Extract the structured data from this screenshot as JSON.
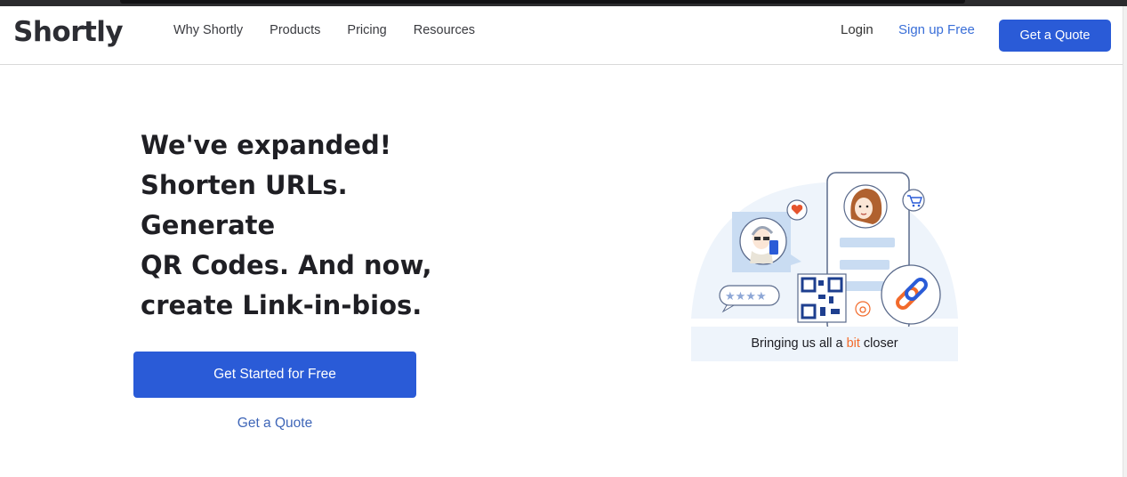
{
  "header": {
    "logo": "Shortly",
    "menu": [
      "Why Shortly",
      "Products",
      "Pricing",
      "Resources"
    ],
    "login": "Login",
    "signup": "Sign up Free",
    "quote_button": "Get a Quote"
  },
  "hero": {
    "headline_lines": [
      "We've expanded!",
      "Shorten URLs.",
      "Generate",
      "QR Codes. And now,",
      "create Link-in-bios."
    ],
    "primary_cta": "Get Started for Free",
    "secondary_cta": "Get a Quote"
  },
  "illustration": {
    "caption_before": "Bringing us all a ",
    "caption_accent": "bit",
    "caption_after": " closer",
    "icons": [
      "person-avatar-icon",
      "heart-icon",
      "cart-icon",
      "star-rating-icon",
      "qr-code-icon",
      "link-icon"
    ]
  },
  "colors": {
    "brand_blue": "#2a5bd7",
    "link_blue": "#3a6fd8",
    "accent_orange": "#f26a2b",
    "light_blue": "#eef4fb"
  }
}
